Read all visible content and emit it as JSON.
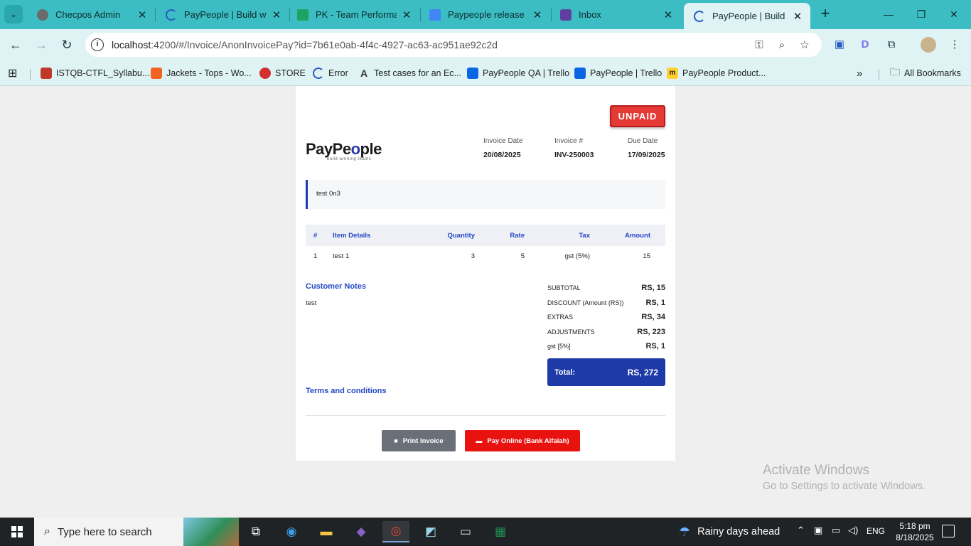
{
  "browser": {
    "tabs": [
      {
        "title": "Checpos Admin",
        "color": "#6b6b6b"
      },
      {
        "title": "PayPeople | Build winning",
        "color": "#2b59c3"
      },
      {
        "title": "PK - Team Performance",
        "color": "#1ea362"
      },
      {
        "title": "Paypeople release notes",
        "color": "#4285f4"
      },
      {
        "title": "Inbox",
        "color": "#5f3fa0"
      },
      {
        "title": "PayPeople | Build winning",
        "color": "#2b59c3"
      }
    ],
    "url_host": "localhost",
    "url_path": ":4200/#/Invoice/AnonInvoicePay?id=7b61e0ab-4f4c-4927-ac63-ac951ae92c2d",
    "bookmarks": [
      {
        "label": "ISTQB-CTFL_Syllabu...",
        "icon": "istqb-icon",
        "color": "#c0392b"
      },
      {
        "label": "Jackets - Tops - Wo...",
        "icon": "magento-icon",
        "color": "#f26322"
      },
      {
        "label": "STORE",
        "icon": "store-icon",
        "color": "#d32f2f"
      },
      {
        "label": "Error",
        "icon": "loading-icon",
        "color": "#2b59c3"
      },
      {
        "label": "Test cases for an Ec...",
        "icon": "a-icon",
        "color": "#333333"
      },
      {
        "label": "PayPeople QA | Trello",
        "icon": "trello-icon",
        "color": "#0c66e4"
      },
      {
        "label": "PayPeople | Trello",
        "icon": "trello-icon",
        "color": "#0c66e4"
      },
      {
        "label": "PayPeople Product...",
        "icon": "miro-icon",
        "color": "#ffd02f"
      }
    ],
    "all_bookmarks": "All Bookmarks"
  },
  "invoice": {
    "status": "UNPAID",
    "logo_main": "PayPe",
    "logo_o": "o",
    "logo_tail": "ple",
    "logo_sub": "build winning teams",
    "invoice_date_label": "Invoice Date",
    "invoice_date": "20/08/2025",
    "invoice_no_label": "Invoice #",
    "invoice_no": "INV-250003",
    "due_date_label": "Due Date",
    "due_date": "17/09/2025",
    "note": "test 0n3",
    "table_headers": {
      "num": "#",
      "item": "Item Details",
      "qty": "Quantity",
      "rate": "Rate",
      "tax": "Tax",
      "amount": "Amount"
    },
    "items": [
      {
        "num": "1",
        "item": "test 1",
        "qty": "3",
        "rate": "5",
        "tax": "gst (5%)",
        "amount": "15"
      }
    ],
    "customer_notes_title": "Customer Notes",
    "customer_notes": "test",
    "terms_title": "Terms and conditions",
    "totals": [
      {
        "label": "SUBTOTAL",
        "value": "RS, 15"
      },
      {
        "label": "DISCOUNT (Amount (RS))",
        "value": "RS, 1"
      },
      {
        "label": "EXTRAS",
        "value": "RS, 34"
      },
      {
        "label": "ADJUSTMENTS",
        "value": "RS, 223"
      },
      {
        "label": "gst [5%]",
        "value": "RS, 1"
      }
    ],
    "total_label": "Total:",
    "total_value": "RS, 272",
    "print_label": "Print Invoice",
    "pay_label": "Pay Online (Bank Alfalah)"
  },
  "watermark": {
    "line1": "Activate Windows",
    "line2": "Go to Settings to activate Windows."
  },
  "taskbar": {
    "search_placeholder": "Type here to search",
    "weather": "Rainy days ahead",
    "lang": "ENG",
    "time": "5:18 pm",
    "date": "8/18/2025"
  },
  "colors": {
    "chrome_accent": "#3bbdc3",
    "brand_blue": "#1d3aa8",
    "unpaid_red": "#e53935",
    "pay_red": "#e8120f"
  }
}
